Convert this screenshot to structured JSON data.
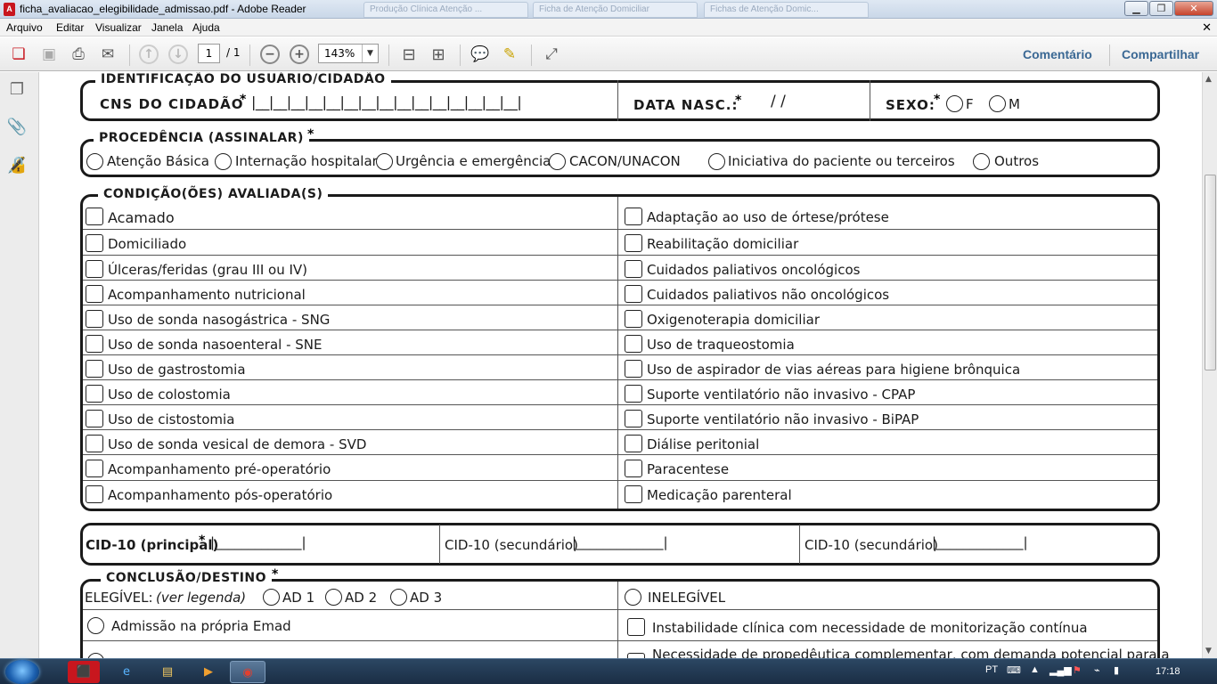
{
  "window": {
    "title": "ficha_avaliacao_elegibilidade_admissao.pdf - Adobe Reader",
    "app_icon": "adobe-reader-icon",
    "background_tabs": [
      "Produção Clínica Atenção ...",
      "Ficha de Atenção Domiciliar",
      "Fichas de Atenção Domic..."
    ]
  },
  "menu": {
    "items": [
      "Arquivo",
      "Editar",
      "Visualizar",
      "Janela",
      "Ajuda"
    ]
  },
  "toolbar": {
    "page_current": "1",
    "page_total": "/ 1",
    "zoom": "143%",
    "comment_label": "Comentário",
    "share_label": "Compartilhar"
  },
  "form": {
    "identificacao": {
      "title": "IDENTIFICAÇÃO DO USUÁRIO/CIDADÃO",
      "cns_label": "CNS DO CIDADÃO",
      "cns_slots": "|__|__|__|__|__|__|__|__|__|__|__|__|__|__|__|",
      "data_label": "DATA NASC.:",
      "data_slashes": "/          /",
      "sexo_label": "SEXO:",
      "sexo_f": "F",
      "sexo_m": "M"
    },
    "procedencia": {
      "title": "PROCEDÊNCIA (ASSINALAR)",
      "options": [
        "Atenção Básica",
        "Internação hospitalar",
        "Urgência e emergência",
        "CACON/UNACON",
        "Iniciativa do paciente ou terceiros",
        "Outros"
      ]
    },
    "condicoes": {
      "title": "CONDIÇÃO(ÕES) AVALIADA(S)",
      "left": [
        "Acamado",
        "Domiciliado",
        "Úlceras/feridas (grau III ou IV)",
        "Acompanhamento nutricional",
        "Uso de sonda nasogástrica - SNG",
        "Uso de sonda nasoenteral - SNE",
        "Uso de gastrostomia",
        "Uso de colostomia",
        "Uso de cistostomia",
        "Uso de sonda vesical de demora - SVD",
        "Acompanhamento pré-operatório",
        "Acompanhamento pós-operatório"
      ],
      "right": [
        "Adaptação ao uso de órtese/prótese",
        "Reabilitação domiciliar",
        "Cuidados paliativos oncológicos",
        "Cuidados paliativos não oncológicos",
        "Oxigenoterapia domiciliar",
        "Uso de traqueostomia",
        "Uso de aspirador de vias aéreas para higiene brônquica",
        "Suporte ventilatório não invasivo - CPAP",
        "Suporte ventilatório não invasivo - BiPAP",
        "Diálise peritonial",
        "Paracentese",
        "Medicação parenteral"
      ]
    },
    "cid": {
      "principal": "CID-10 (principal)",
      "secundario_1": "CID-10 (secundário)",
      "secundario_2": "CID-10 (secundário)",
      "field": "|_____________|"
    },
    "conclusao": {
      "title": "CONCLUSÃO/DESTINO",
      "elegivel": "ELEGÍVEL:",
      "legenda": "(ver legenda)",
      "ad1": "AD 1",
      "ad2": "AD 2",
      "ad3": "AD 3",
      "inelegivel": "INELEGÍVEL",
      "admissao": "Admissão na própria Emad",
      "instabilidade": "Instabilidade clínica com necessidade de monitorização contínua",
      "necessidade": "Necessidade de propedêutica complementar, com demanda potencial para a"
    },
    "asterisk": "*"
  },
  "taskbar": {
    "lang": "PT",
    "time": "17:18"
  }
}
